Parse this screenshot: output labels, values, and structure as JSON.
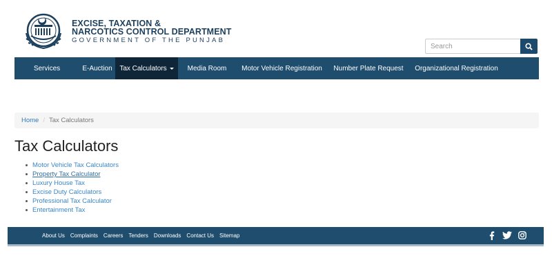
{
  "brand": {
    "line1": "EXCISE, TAXATION &",
    "line2": "NARCOTICS CONTROL DEPARTMENT",
    "line3": "GOVERNMENT OF THE PUNJAB"
  },
  "search": {
    "placeholder": "Search"
  },
  "nav": {
    "items": [
      {
        "label": "Services"
      },
      {
        "label": "E-Auction"
      },
      {
        "label": "Tax Calculators"
      },
      {
        "label": "Media Room"
      },
      {
        "label": "Motor Vehicle Registration"
      },
      {
        "label": "Number Plate Request"
      },
      {
        "label": "Organizational Registration"
      }
    ]
  },
  "breadcrumb": {
    "home": "Home",
    "separator": "/",
    "current": "Tax Calculators"
  },
  "page": {
    "title": "Tax Calculators"
  },
  "calculators": [
    {
      "label": "Motor Vehicle Tax Calculators"
    },
    {
      "label": "Property Tax Calculator"
    },
    {
      "label": "Luxury House Tax"
    },
    {
      "label": "Excise Duty Calculators"
    },
    {
      "label": "Professional Tax Calculator"
    },
    {
      "label": "Entertainment Tax"
    }
  ],
  "footer": {
    "links": [
      {
        "label": "About Us"
      },
      {
        "label": "Complaints"
      },
      {
        "label": "Careers"
      },
      {
        "label": "Tenders"
      },
      {
        "label": "Downloads"
      },
      {
        "label": "Contact Us"
      },
      {
        "label": "Sitemap"
      }
    ],
    "social": [
      "facebook-icon",
      "twitter-icon",
      "instagram-icon"
    ]
  },
  "colors": {
    "navbar": "#1f4d6e",
    "nav_active": "#0f2638",
    "link": "#337ab7",
    "brand": "#1c3f5c"
  }
}
